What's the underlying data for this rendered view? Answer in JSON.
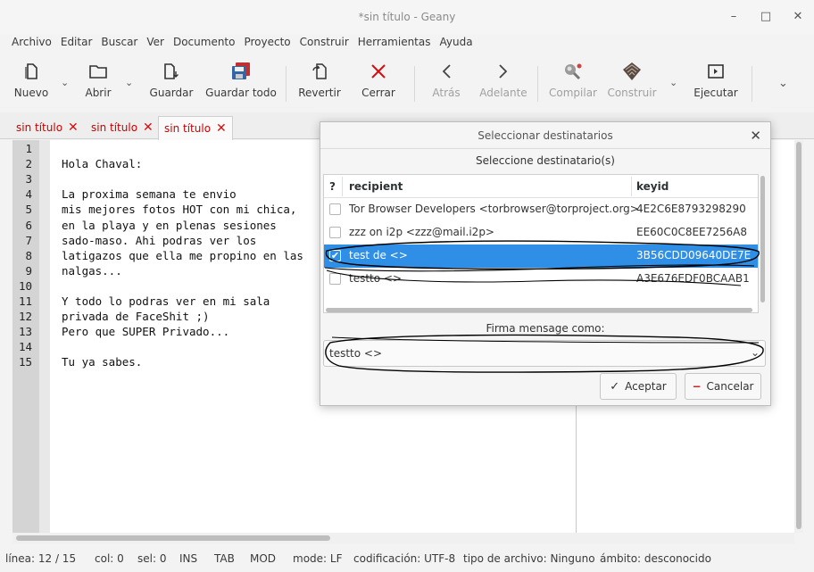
{
  "window": {
    "title": "*sin título - Geany",
    "minimize": "–",
    "maximize": "□",
    "close": "✕"
  },
  "menu": [
    "Archivo",
    "Editar",
    "Buscar",
    "Ver",
    "Documento",
    "Proyecto",
    "Construir",
    "Herramientas",
    "Ayuda"
  ],
  "toolbar": {
    "new": "Nuevo",
    "open": "Abrir",
    "save": "Guardar",
    "save_all": "Guardar todo",
    "revert": "Revertir",
    "close": "Cerrar",
    "back": "Atrás",
    "forward": "Adelante",
    "compile": "Compilar",
    "build": "Construir",
    "execute": "Ejecutar"
  },
  "tabs": [
    "sin título",
    "sin título",
    "sin título"
  ],
  "editor": {
    "line_numbers": [
      "1",
      "2",
      "3",
      "4",
      "5",
      "6",
      "7",
      "8",
      "9",
      "10",
      "11",
      "12",
      "13",
      "14",
      "15"
    ],
    "lines": [
      "",
      "Hola Chaval:",
      "",
      "La proxima semana te envio",
      "mis mejores fotos HOT con mi chica,",
      "en la playa y en plenas sesiones",
      "sado-maso. Ahi podras ver los",
      "latigazos que ella me propino en las",
      "nalgas...",
      "",
      "Y todo lo podras ver en mi sala",
      "privada de FaceShit ;)",
      "Pero que SUPER Privado...",
      "",
      "Tu ya sabes."
    ]
  },
  "dialog": {
    "title": "Seleccionar destinatarios",
    "close": "✕",
    "subtitle": "Seleccione destinatario(s)",
    "columns": {
      "check": "?",
      "recipient": "recipient",
      "keyid": "keyid"
    },
    "rows": [
      {
        "recipient": "Tor Browser Developers    <torbrowser@torproject.org>",
        "keyid": "4E2C6E8793298290",
        "checked": false
      },
      {
        "recipient": "zzz on i2p    <zzz@mail.i2p>",
        "keyid": "EE60C0C8EE7256A8",
        "checked": false
      },
      {
        "recipient": "test de    <>",
        "keyid": "3B56CDD09640DE7E",
        "checked": true
      },
      {
        "recipient": "testto    <>",
        "keyid": "A3E676EDF0BCAAB1",
        "checked": false
      }
    ],
    "sign_label": "Firma mensage como:",
    "sign_value": "testto    <>",
    "accept": "Aceptar",
    "cancel": "Cancelar"
  },
  "status": {
    "line": "línea: 12 / 15",
    "col": "col: 0",
    "sel": "sel: 0",
    "ins": "INS",
    "tab": "TAB",
    "mod": "MOD",
    "mode": "mode: LF",
    "encoding": "codificación: UTF-8",
    "filetype": "tipo de archivo: Ninguno",
    "scope": "ámbito: desconocido"
  },
  "colors": {
    "selection": "#2f8fe6",
    "tab_text": "#cc0000",
    "close_red": "#d01010"
  }
}
